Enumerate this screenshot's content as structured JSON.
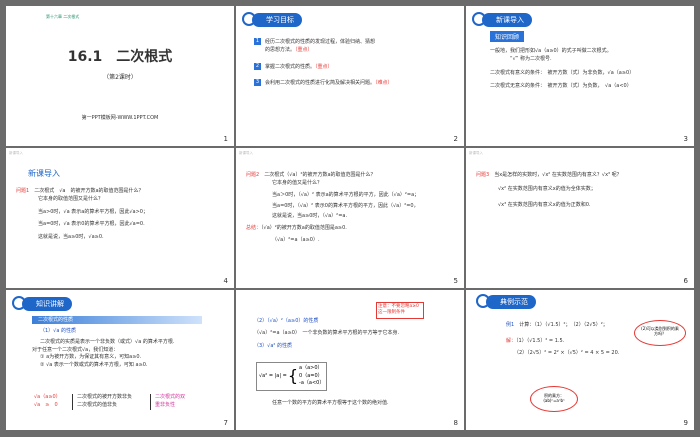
{
  "slides": [
    {
      "page": "1",
      "top_banner": "第十六章 二次根式",
      "title": "16.1　二次根式",
      "subtitle": "（第2课时）",
      "footer": "第一PPT模板网-WWW.1PPT.COM"
    },
    {
      "page": "2",
      "heading": "学习目标",
      "goals": [
        {
          "num": "1",
          "text": "经历二次根式的性质的发现过程，体验归纳、猜想",
          "text2": "的思想方法。",
          "tag": "（重点）"
        },
        {
          "num": "2",
          "text": "掌握二次根式的性质。",
          "tag": "（重点）"
        },
        {
          "num": "3",
          "text": "会利用二次根式的性质进行化简及解决相关问题。",
          "tag": "（难点）"
        }
      ]
    },
    {
      "page": "3",
      "heading": "新课导入",
      "subheading": "知识回顾",
      "lines": [
        "一般地，我们把形如√a（a≥0）的式子叫做二次根式。",
        "“√” 称为二次根号.",
        "二次根式有意义的条件：　被开方数（式）为非负数，√a（a≥0）",
        "二次根式无意义的条件：　被开方数（式）为负数，　√a（a<0）"
      ]
    },
    {
      "page": "4",
      "tag": "新课导入",
      "heading": "新课导入",
      "q_label": "问题1",
      "q_text": "二次根式　√a　的被开方数a的取值范围是什么？",
      "q_text2": "它本身的取值范围又是什么？",
      "lines": [
        "当a>0时，√a 表示a的算术平方根，因此√a>0；",
        "当a=0时，√a 表示0的算术平方根，因此√a=0.",
        "这就是说，当a≥0时，√a≥0."
      ]
    },
    {
      "page": "5",
      "tag": "新课导入",
      "q_label": "问题2",
      "q_text": "二次根式（√a）²的被开方数a的取值范围是什么？",
      "q_text2": "它本身的值又是什么？",
      "lines": [
        "当a＞0时，（√a）² 表示a的算术平方根的平方，因此（√a）²=a；",
        "当a=0时，（√a）² 表示0的算术平方根的平方，因此（√a）²=0，",
        "这就是说，当a≥0时，（√a）²=a."
      ],
      "summary_label": "总结：",
      "summary_text": "（√a）²的被开方数a的取值范围是a≥0.",
      "summary_formula": "（√a）²=a（a≥0）."
    },
    {
      "page": "6",
      "tag": "新课导入",
      "q_label": "问题3",
      "q_text": "当x是怎样的实数时，√x² 在实数范围内有意义？√x³ 呢？",
      "lines": [
        "√x² 在实数范围内有意义x的值为全体实数；",
        "√x³ 在实数范围内有意义x的值为正数和0."
      ],
      "red1": "后者x为正数和0."
    },
    {
      "page": "7",
      "heading": "知识讲解",
      "bar": "二次根式的性质",
      "sub": "（1）√a 的性质",
      "lines": [
        "二次根式的实质是表示一个非负数（或式）√a 的算术平方根.",
        "对于任意一个二次根式√a，我们知道：",
        "① a为被开方数，为保证其有意义，可知a≥0.",
        "② √a 表示一个数或式的算术平方根，可知 a≥0."
      ],
      "table_left1": "√a（a≥0）",
      "table_left2": "√a　≥　0",
      "table_mid1": "二次根式的被开方数非负",
      "table_mid2": "二次根式的值非负",
      "table_right": "二次根式的双重非负性"
    },
    {
      "page": "8",
      "note": "注意：不要忽略a≥0这一限制条件",
      "title2": "（2）（√a）²（a≥0）的性质",
      "line2": "（√a）²=a（a≥0）　一个非负数的算术平方根的平方等于它本身.",
      "title3": "（3）√a² 的性质",
      "piecewise": [
        "a（a>0）",
        "0（a=0）",
        "-a（a<0）"
      ],
      "lhs": "√a² = |a| =",
      "line3": "任意一个数的平方的算术平方根等于这个数的绝对值."
    },
    {
      "page": "9",
      "heading": "典例示范",
      "ex_label": "例1",
      "ex_text": "计算：（1）（√1.5）²；　（2）（2√5）²；",
      "sol_label": "解：",
      "sol1": "（1）（√1.5）² = 1.5.",
      "sol2": "（2）（2√5）² = 2² ×（√5）² = 4 × 5 = 20.",
      "bubble1": "(2)可以类别到积的乘方吗？",
      "bubble2": "积的乘方：(ab)ⁿ=aⁿbⁿ"
    }
  ]
}
